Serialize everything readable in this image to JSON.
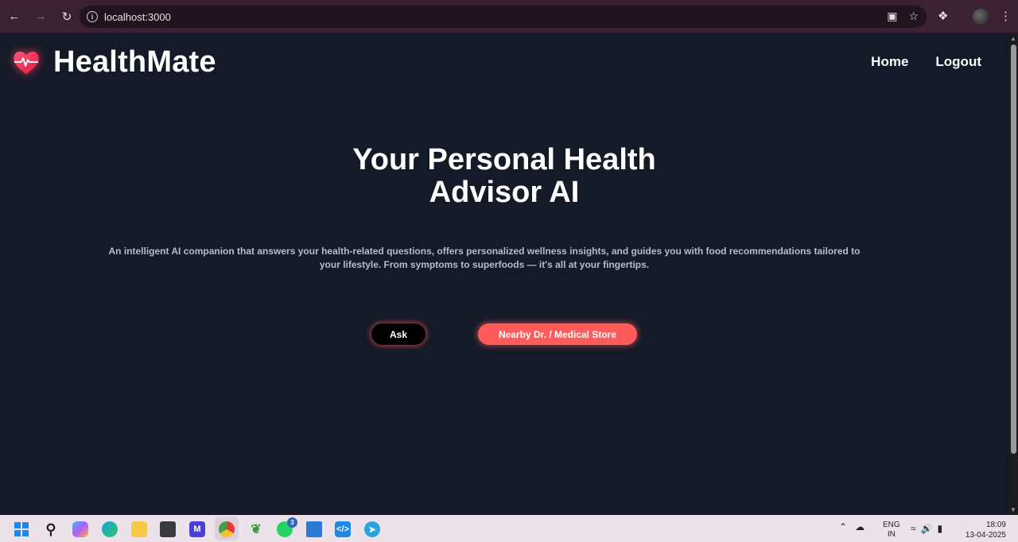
{
  "browser": {
    "url": "localhost:3000",
    "back_icon": "arrow-left",
    "forward_icon": "arrow-right",
    "reload_icon": "reload"
  },
  "header": {
    "brand": "HealthMate",
    "nav": [
      {
        "label": "Home"
      },
      {
        "label": "Logout"
      }
    ]
  },
  "hero": {
    "title_line1": "Your Personal Health",
    "title_line2": "Advisor AI",
    "description": "An intelligent AI companion that answers your health-related questions, offers personalized wellness insights, and guides you with food recommendations tailored to your lifestyle. From symptoms to superfoods — it's all at your fingertips.",
    "ask_button": "Ask",
    "nearby_button": "Nearby Dr. / Medical Store"
  },
  "colors": {
    "page_bg": "#141a28",
    "accent": "#ff5b5b",
    "chrome_bg": "#3a2233"
  },
  "taskbar": {
    "whatsapp_badge": "3",
    "lang_line1": "ENG",
    "lang_line2": "IN",
    "time": "18:09",
    "date": "13-04-2025"
  }
}
